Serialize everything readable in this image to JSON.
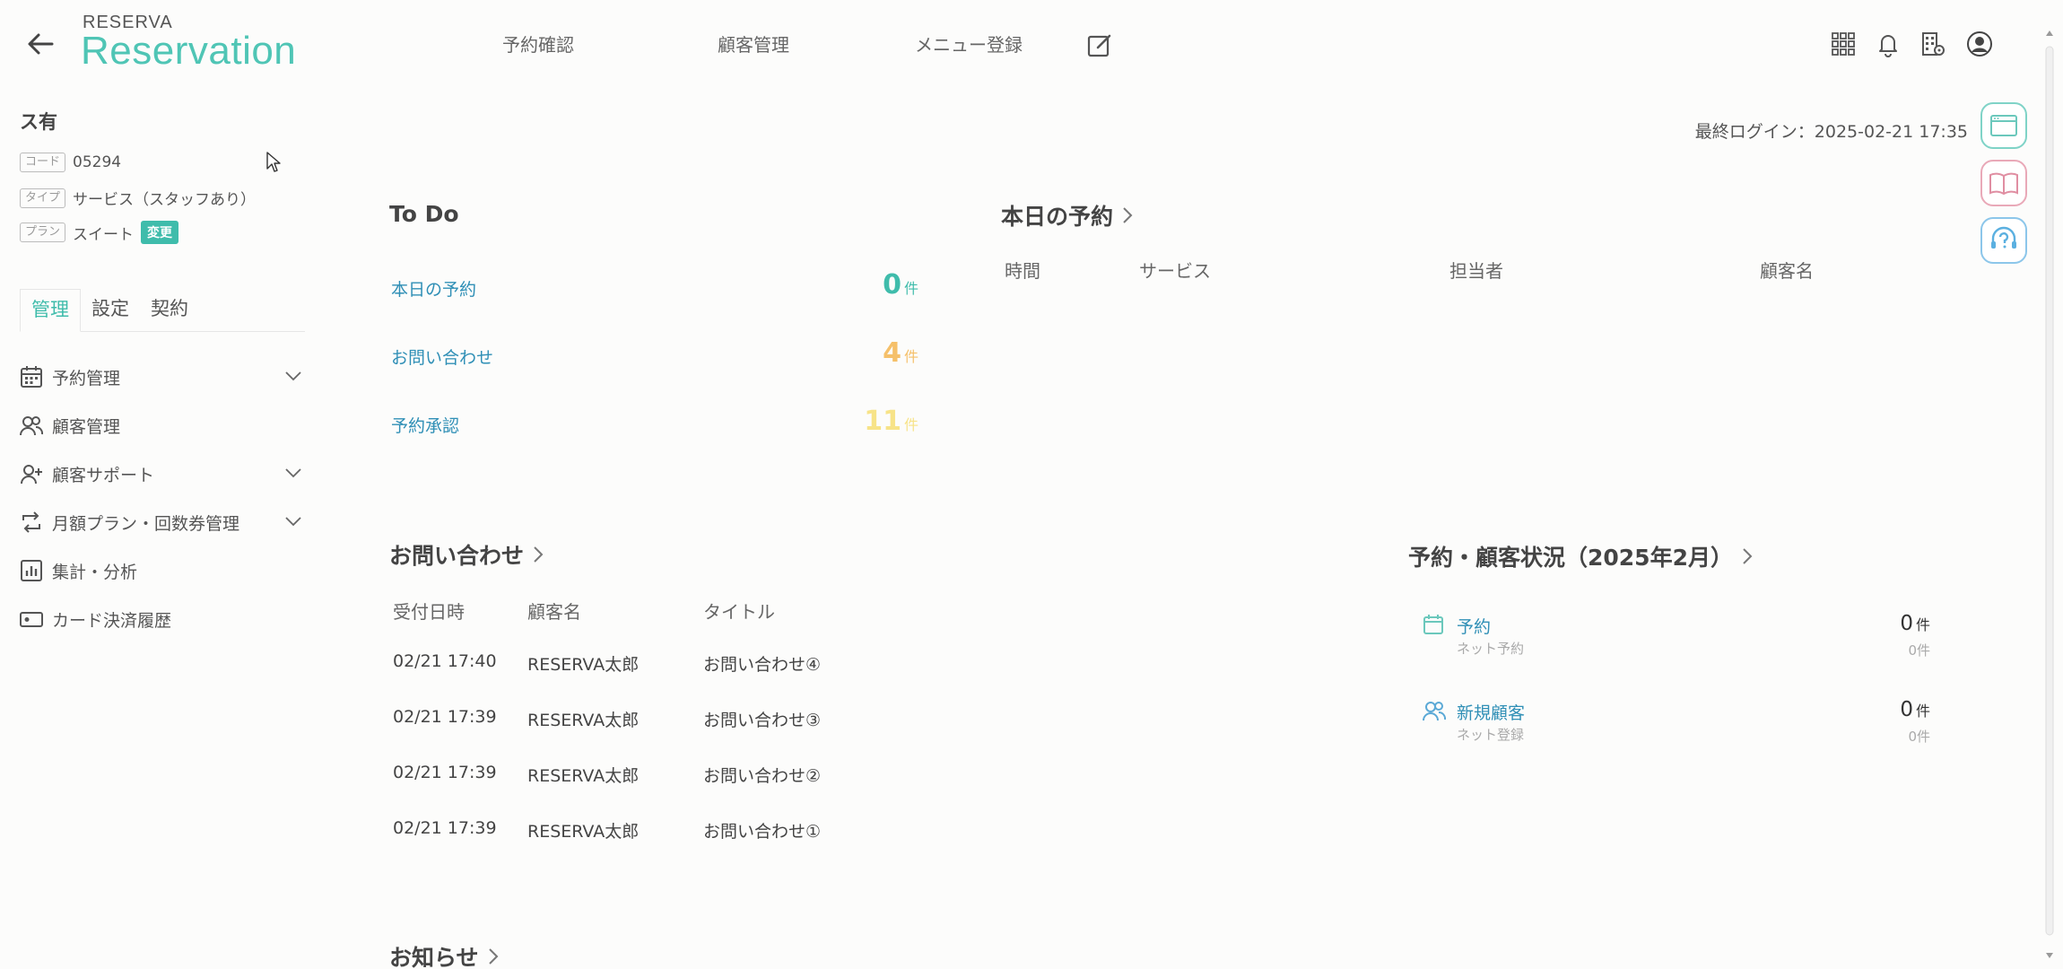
{
  "header": {
    "brand_small": "RESERVA",
    "brand_title": "Reservation",
    "nav": [
      "予約確認",
      "顧客管理",
      "メニュー登録"
    ]
  },
  "sidebar": {
    "org_name": "ス有",
    "code_tag": "コード",
    "code_value": "05294",
    "type_tag": "タイプ",
    "type_value": "サービス（スタッフあり）",
    "plan_tag": "プラン",
    "plan_value": "スイート",
    "change_label": "変更",
    "tabs": [
      "管理",
      "設定",
      "契約"
    ],
    "items": [
      {
        "label": "予約管理"
      },
      {
        "label": "顧客管理"
      },
      {
        "label": "顧客サポート"
      },
      {
        "label": "月額プラン・回数券管理"
      },
      {
        "label": "集計・分析"
      },
      {
        "label": "カード決済履歴"
      }
    ]
  },
  "last_login": "最終ログイン：2025-02-21 17:35",
  "todo": {
    "title": "To Do",
    "unit": "件",
    "rows": [
      {
        "label": "本日の予約",
        "count": "0",
        "color": "#3fbcab"
      },
      {
        "label": "お問い合わせ",
        "count": "4",
        "color": "#f5c06a"
      },
      {
        "label": "予約承認",
        "count": "11",
        "color": "#f7e388"
      }
    ]
  },
  "today": {
    "title": "本日の予約",
    "columns": [
      "時間",
      "サービス",
      "担当者",
      "顧客名"
    ]
  },
  "inquiries": {
    "title": "お問い合わせ",
    "columns": [
      "受付日時",
      "顧客名",
      "タイトル"
    ],
    "rows": [
      {
        "date": "02/21 17:40",
        "name": "RESERVA太郎",
        "title": "お問い合わせ④"
      },
      {
        "date": "02/21 17:39",
        "name": "RESERVA太郎",
        "title": "お問い合わせ③"
      },
      {
        "date": "02/21 17:39",
        "name": "RESERVA太郎",
        "title": "お問い合わせ②"
      },
      {
        "date": "02/21 17:39",
        "name": "RESERVA太郎",
        "title": "お問い合わせ①"
      }
    ]
  },
  "status": {
    "title": "予約・顧客状況（2025年2月）",
    "unit": "件",
    "items": [
      {
        "label": "予約",
        "sub": "ネット予約",
        "value": "0",
        "subvalue": "0件"
      },
      {
        "label": "新規顧客",
        "sub": "ネット登録",
        "value": "0",
        "subvalue": "0件"
      }
    ]
  },
  "news": {
    "title": "お知らせ"
  },
  "colors": {
    "accent": "#3fbcab",
    "link": "#2f8fb6"
  }
}
